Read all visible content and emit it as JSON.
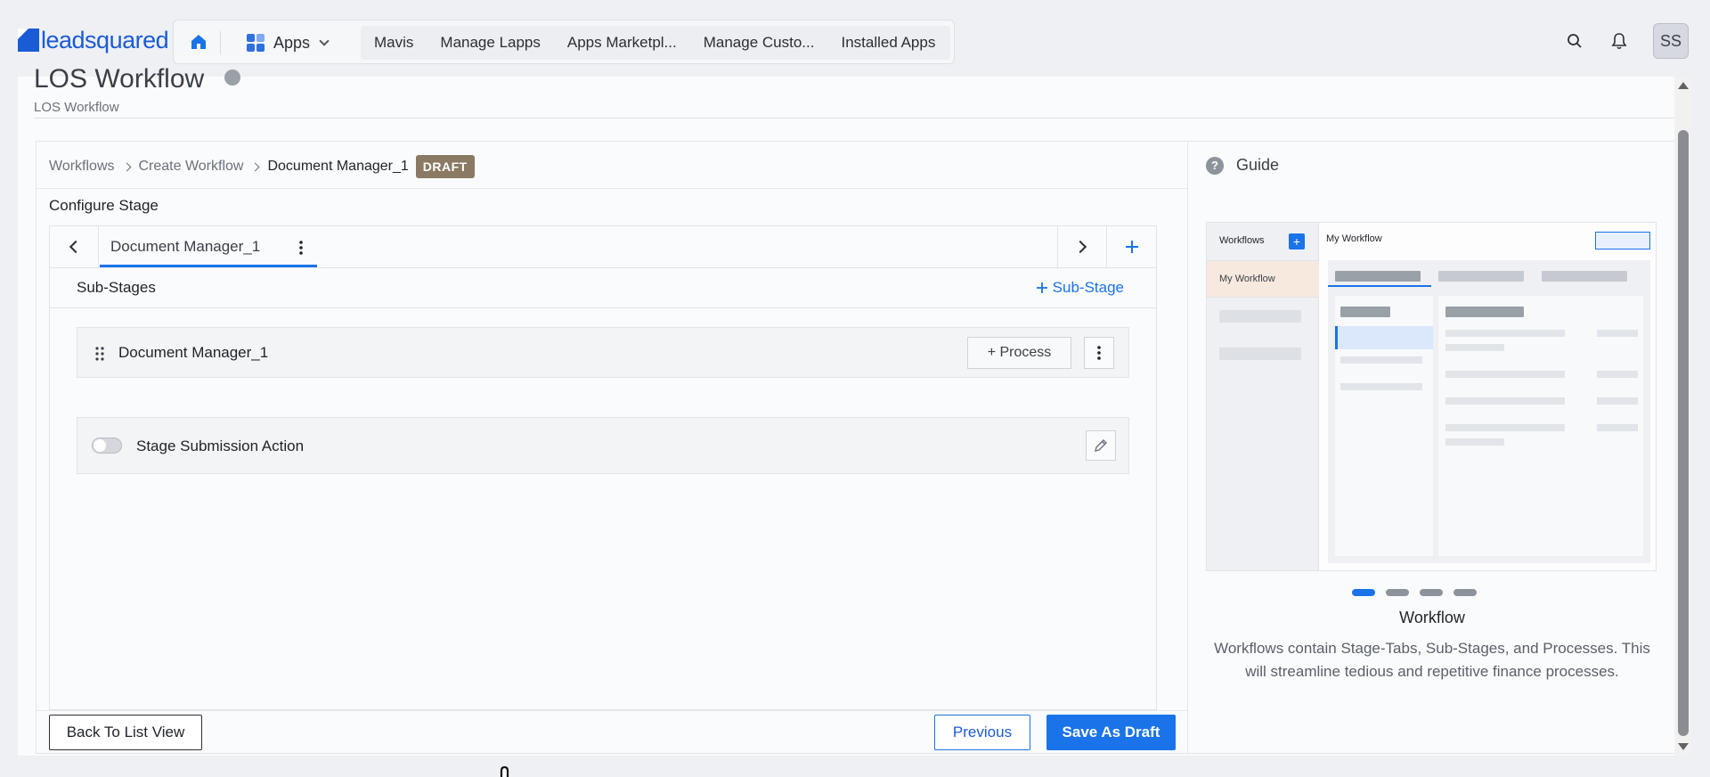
{
  "topnav": {
    "logo_text": "leadsquared",
    "apps_label": "Apps",
    "links": [
      "Mavis",
      "Manage Lapps",
      "Apps Marketpl...",
      "Manage Custo...",
      "Installed Apps"
    ],
    "avatar_initials": "SS",
    "icons": [
      "home-icon",
      "apps-grid-icon",
      "search-icon",
      "bell-icon"
    ]
  },
  "page": {
    "title": "LOS Workflow",
    "subtitle": "LOS Workflow"
  },
  "breadcrumb": {
    "items": [
      "Workflows",
      "Create Workflow",
      "Document Manager_1"
    ],
    "badge": "DRAFT"
  },
  "configure": {
    "title": "Configure Stage",
    "active_tab": "Document Manager_1",
    "substages_title": "Sub-Stages",
    "add_substage": "Sub-Stage",
    "substage_name": "Document Manager_1",
    "process_button": "+ Process",
    "submission_label": "Stage Submission Action",
    "submission_enabled": false
  },
  "footer": {
    "back": "Back To List View",
    "previous": "Previous",
    "save": "Save As Draft"
  },
  "guide": {
    "title": "Guide",
    "preview": {
      "sidebar_title": "Workflows",
      "selected_item": "My Workflow",
      "main_title": "My Workflow"
    },
    "carousel": {
      "count": 4,
      "active": 1
    },
    "caption": "Workflow",
    "description": "Workflows contain Stage-Tabs, Sub-Stages, and Processes. This will streamline tedious and repetitive finance processes."
  },
  "colors": {
    "accent": "#1a73e8",
    "brand": "#1a5bd6",
    "draft_badge": "#8a7a63"
  }
}
